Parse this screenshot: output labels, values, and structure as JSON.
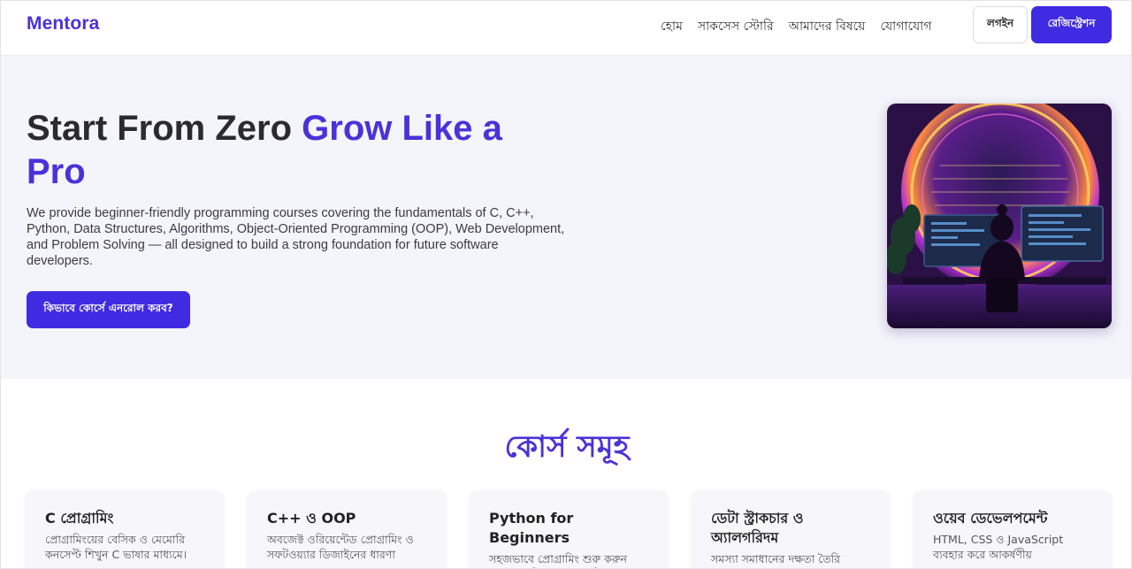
{
  "header": {
    "logo": "Mentora",
    "nav": [
      {
        "label": "হোম"
      },
      {
        "label": "সাকসেস স্টোরি"
      },
      {
        "label": "আমাদের বিষয়ে"
      },
      {
        "label": "যোগাযোগ"
      }
    ],
    "login_label": "লগইন",
    "register_label": "রেজিস্ট্রেশন"
  },
  "hero": {
    "title_part1": "Start From Zero ",
    "title_accent": "Grow Like a Pro",
    "description": "We provide beginner-friendly programming courses covering the fundamentals of C, C++, Python, Data Structures, Algorithms, Object-Oriented Programming (OOP), Web Development, and Problem Solving — all designed to build a strong foundation for future software developers.",
    "cta_label": "কিভাবে কোর্সে এনরোল করব?"
  },
  "courses": {
    "title": "কোর্স সমূহ",
    "items": [
      {
        "title": "C প্রোগ্রামিং",
        "desc": "প্রোগ্রামিংয়ের বেসিক ও মেমোরি কনসেপ্ট শিখুন C ভাষার মাধ্যমে।"
      },
      {
        "title": "C++ ও OOP",
        "desc": "অবজেক্ট ওরিয়েন্টেড প্রোগ্রামিং ও সফটওয়্যার ডিজাইনের ধারণা"
      },
      {
        "title": "Python for Beginners",
        "desc": "সহজভাবে প্রোগ্রামিং শুরু করুন Python দিয়ে, যা দ্রুত শিখতে"
      },
      {
        "title": "ডেটা স্ট্রাকচার ও অ্যালগরিদম",
        "desc": "সমস্যা সমাধানের দক্ষতা তৈরি"
      },
      {
        "title": "ওয়েব ডেভেলপমেন্ট",
        "desc": "HTML, CSS ও JavaScript ব্যবহার করে আকর্ষণীয়"
      }
    ]
  },
  "colors": {
    "accent": "#4a32d9",
    "button": "#3f2be2",
    "hero_bg": "#f4f4fb"
  }
}
